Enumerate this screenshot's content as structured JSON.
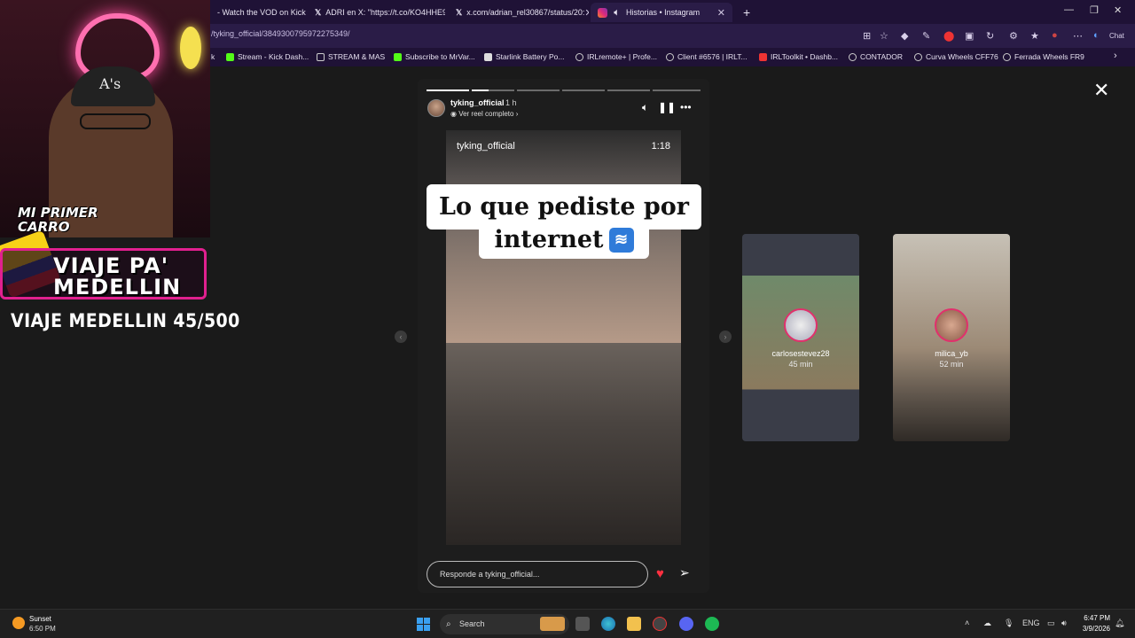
{
  "browser": {
    "tabs": [
      {
        "label": "- Watch the VOD on Kick",
        "icon": "kick-icon"
      },
      {
        "label": "ADRI en X: \"https://t.co/KO4HHE94",
        "icon": "x-icon"
      },
      {
        "label": "x.com/adrian_rel30867/status/20:",
        "icon": "x-icon"
      },
      {
        "label": "Historias • Instagram",
        "icon": "instagram-icon"
      }
    ],
    "url": "/tyking_official/3849300795972275349/",
    "bookmarks": [
      "Stream - Kick Dash...",
      "STREAM & MAS",
      "Subscribe to MrVar...",
      "Starlink Battery Po...",
      "IRLremote+ | Profe...",
      "Client #6576 | IRLT...",
      "IRLToolkit • Dashb...",
      "CONTADOR",
      "Curva Wheels CFF76",
      "Ferrada Wheels FR9"
    ],
    "chat_label": "Chat"
  },
  "story": {
    "username": "tyking_official",
    "time_ago": "1 h",
    "reel_link": "Ver reel completo",
    "video_username": "tyking_official",
    "video_duration": "1:18",
    "caption_line1": "Lo que pediste por",
    "caption_line2": "internet",
    "reply_placeholder": "Responde a tyking_official...",
    "progress_segments": 6,
    "progress_current": 1
  },
  "side_stories": [
    {
      "name": "carlosestevez28",
      "ago": "45 min"
    },
    {
      "name": "milica_yb",
      "ago": "52 min"
    }
  ],
  "overlay": {
    "sticker": "MI PRIMER CARRO",
    "banner_line1": "VIAJE PA'",
    "banner_line2": "MEDELLIN",
    "counter": "VIAJE MEDELLIN 45/500"
  },
  "taskbar": {
    "weather_name": "Sunset",
    "weather_time": "6:50 PM",
    "search_label": "Search",
    "lang": "ENG",
    "clock_time": "6:47 PM",
    "clock_date": "3/9/2026"
  }
}
